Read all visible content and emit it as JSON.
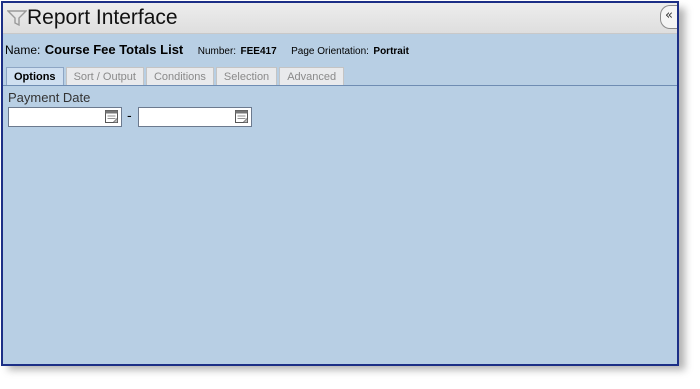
{
  "window": {
    "title": "Report Interface",
    "collapse_glyph": "«"
  },
  "report": {
    "name_label": "Name:",
    "name_value": "Course Fee Totals List",
    "number_label": "Number:",
    "number_value": "FEE417",
    "orientation_label": "Page Orientation:",
    "orientation_value": "Portrait"
  },
  "tabs": [
    {
      "label": "Options",
      "active": true
    },
    {
      "label": "Sort / Output",
      "active": false
    },
    {
      "label": "Conditions",
      "active": false
    },
    {
      "label": "Selection",
      "active": false
    },
    {
      "label": "Advanced",
      "active": false
    }
  ],
  "payment_date": {
    "label": "Payment Date",
    "from_value": "",
    "to_value": "",
    "separator": "-"
  },
  "icons": {
    "title": "funnel-icon",
    "date_picker": "calendar-icon"
  },
  "colors": {
    "window_border": "#1c2f86",
    "panel_background": "#b8cfe4",
    "active_tab": "#cfdff0",
    "inactive_tab_text": "#8a8a8a"
  }
}
